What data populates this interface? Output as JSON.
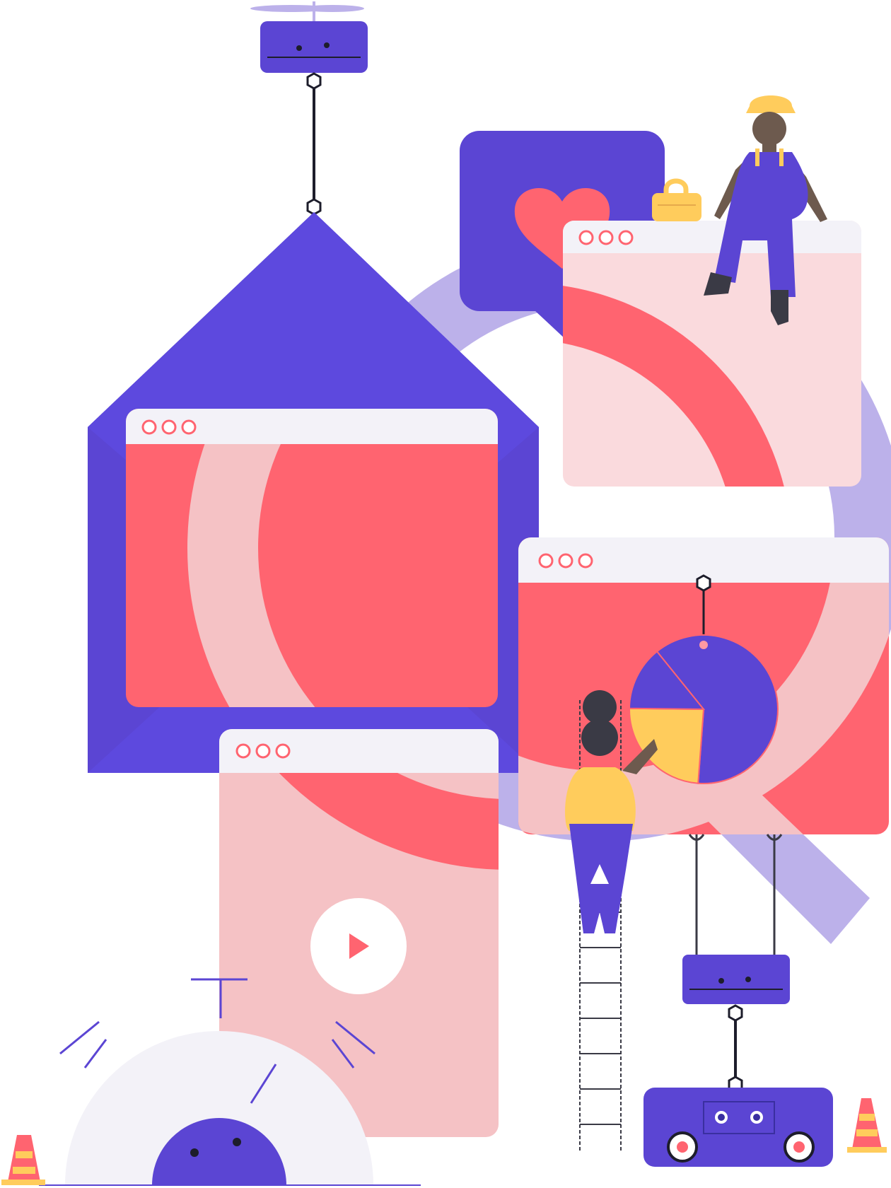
{
  "colors": {
    "purple": "#5b45d3",
    "purple_light": "#bcb1ea",
    "coral": "#ff6470",
    "pink": "#f5c2c5",
    "pink_light": "#fadadd",
    "bar": "#f3f2f8",
    "yellow": "#ffcc5c",
    "skin": "#6d5a4e"
  },
  "icons": [
    "drone-icon",
    "envelope-icon",
    "heart-icon",
    "padlock-icon",
    "pie-chart-icon",
    "play-icon",
    "traffic-cone-icon",
    "robot-icon"
  ],
  "pie_chart": {
    "slices": [
      0.62,
      0.24,
      0.14
    ]
  }
}
